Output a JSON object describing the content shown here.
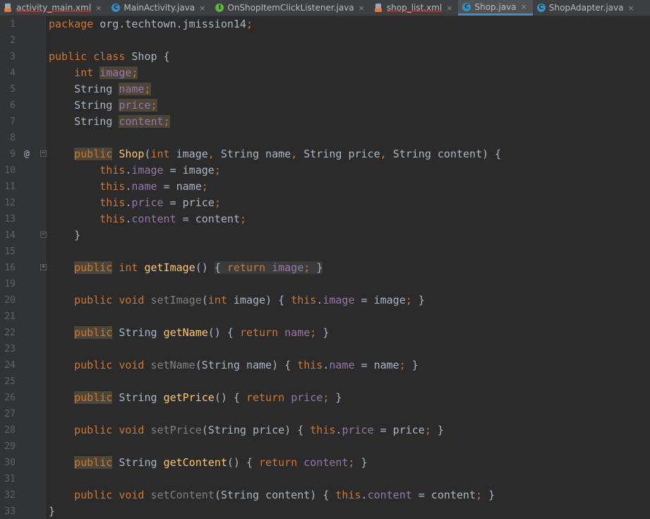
{
  "tabs": [
    {
      "label": "activity_main.xml",
      "icon": "xml-file-icon"
    },
    {
      "label": "MainActivity.java",
      "icon": "java-class-icon"
    },
    {
      "label": "OnShopItemClickListener.java",
      "icon": "java-interface-icon"
    },
    {
      "label": "shop_list.xml",
      "icon": "xml-file-icon"
    },
    {
      "label": "Shop.java",
      "icon": "java-class-icon",
      "active": true
    },
    {
      "label": "ShopAdapter.java",
      "icon": "java-class-icon"
    }
  ],
  "editor": {
    "lines": [
      {
        "n": "1",
        "tokens": [
          [
            "kw",
            "package "
          ],
          [
            "",
            "org.techtown.jmission14"
          ],
          [
            "kw",
            ";"
          ]
        ]
      },
      {
        "n": "2",
        "tokens": []
      },
      {
        "n": "3",
        "tokens": [
          [
            "kw",
            "public class "
          ],
          [
            "",
            "Shop {"
          ]
        ]
      },
      {
        "n": "4",
        "tokens": [
          [
            "",
            "    "
          ],
          [
            "kw",
            "int "
          ],
          [
            "fld hl",
            "image"
          ],
          [
            "kw hl",
            ";"
          ]
        ]
      },
      {
        "n": "5",
        "tokens": [
          [
            "",
            "    String "
          ],
          [
            "fld hl",
            "name"
          ],
          [
            "kw hl",
            ";"
          ]
        ]
      },
      {
        "n": "6",
        "tokens": [
          [
            "",
            "    String "
          ],
          [
            "fld hl",
            "price"
          ],
          [
            "kw hl",
            ";"
          ]
        ]
      },
      {
        "n": "7",
        "tokens": [
          [
            "",
            "    String "
          ],
          [
            "fld hl",
            "content"
          ],
          [
            "kw hl",
            ";"
          ]
        ]
      },
      {
        "n": "8",
        "tokens": []
      },
      {
        "n": "9",
        "mark": "@",
        "fold": "open",
        "tokens": [
          [
            "",
            "    "
          ],
          [
            "kw hl",
            "public"
          ],
          [
            "kw",
            " "
          ],
          [
            "fn",
            "Shop"
          ],
          [
            "",
            "("
          ],
          [
            "kw",
            "int "
          ],
          [
            "",
            "image"
          ],
          [
            "kw",
            ", "
          ],
          [
            "",
            "String name"
          ],
          [
            "kw",
            ", "
          ],
          [
            "",
            "String price"
          ],
          [
            "kw",
            ", "
          ],
          [
            "",
            "String content) {"
          ]
        ]
      },
      {
        "n": "10",
        "tokens": [
          [
            "",
            "        "
          ],
          [
            "kw",
            "this"
          ],
          [
            "",
            "."
          ],
          [
            "fld",
            "image"
          ],
          [
            "",
            " = image"
          ],
          [
            "kw",
            ";"
          ]
        ]
      },
      {
        "n": "11",
        "tokens": [
          [
            "",
            "        "
          ],
          [
            "kw",
            "this"
          ],
          [
            "",
            "."
          ],
          [
            "fld",
            "name"
          ],
          [
            "",
            " = name"
          ],
          [
            "kw",
            ";"
          ]
        ]
      },
      {
        "n": "12",
        "tokens": [
          [
            "",
            "        "
          ],
          [
            "kw",
            "this"
          ],
          [
            "",
            "."
          ],
          [
            "fld",
            "price"
          ],
          [
            "",
            " = price"
          ],
          [
            "kw",
            ";"
          ]
        ]
      },
      {
        "n": "13",
        "tokens": [
          [
            "",
            "        "
          ],
          [
            "kw",
            "this"
          ],
          [
            "",
            "."
          ],
          [
            "fld",
            "content"
          ],
          [
            "",
            " = content"
          ],
          [
            "kw",
            ";"
          ]
        ]
      },
      {
        "n": "14",
        "fold": "close",
        "tokens": [
          [
            "",
            "    }"
          ]
        ]
      },
      {
        "n": "15",
        "tokens": []
      },
      {
        "n": "16",
        "fold": "plus",
        "tokens": [
          [
            "",
            "    "
          ],
          [
            "kw hl",
            "public"
          ],
          [
            "kw",
            " int "
          ],
          [
            "fn",
            "getImage"
          ],
          [
            "",
            "() "
          ],
          [
            "br",
            "{ "
          ],
          [
            "kw br",
            "return "
          ],
          [
            "fld br",
            "image"
          ],
          [
            "kw br",
            "; "
          ],
          [
            "br",
            "}"
          ]
        ]
      },
      {
        "n": "19",
        "tokens": []
      },
      {
        "n": "20",
        "tokens": [
          [
            "",
            "    "
          ],
          [
            "kw",
            "public void "
          ],
          [
            "dim",
            "setImage"
          ],
          [
            "",
            "("
          ],
          [
            "kw",
            "int "
          ],
          [
            "",
            "image) { "
          ],
          [
            "kw",
            "this"
          ],
          [
            "",
            "."
          ],
          [
            "fld",
            "image"
          ],
          [
            "",
            " = image"
          ],
          [
            "kw",
            "; "
          ],
          [
            "",
            "}"
          ]
        ]
      },
      {
        "n": "21",
        "tokens": []
      },
      {
        "n": "22",
        "tokens": [
          [
            "",
            "    "
          ],
          [
            "kw hl",
            "public"
          ],
          [
            "",
            " String "
          ],
          [
            "fn",
            "getName"
          ],
          [
            "",
            "() { "
          ],
          [
            "kw",
            "return "
          ],
          [
            "fld",
            "name"
          ],
          [
            "kw",
            "; "
          ],
          [
            "",
            "}"
          ]
        ]
      },
      {
        "n": "23",
        "tokens": []
      },
      {
        "n": "24",
        "tokens": [
          [
            "",
            "    "
          ],
          [
            "kw",
            "public void "
          ],
          [
            "dim",
            "setName"
          ],
          [
            "",
            "(String name) { "
          ],
          [
            "kw",
            "this"
          ],
          [
            "",
            "."
          ],
          [
            "fld",
            "name"
          ],
          [
            "",
            " = name"
          ],
          [
            "kw",
            "; "
          ],
          [
            "",
            "}"
          ]
        ]
      },
      {
        "n": "25",
        "tokens": []
      },
      {
        "n": "26",
        "tokens": [
          [
            "",
            "    "
          ],
          [
            "kw hl",
            "public"
          ],
          [
            "",
            " String "
          ],
          [
            "fn",
            "getPrice"
          ],
          [
            "",
            "() { "
          ],
          [
            "kw",
            "return "
          ],
          [
            "fld",
            "price"
          ],
          [
            "kw",
            "; "
          ],
          [
            "",
            "}"
          ]
        ]
      },
      {
        "n": "27",
        "tokens": []
      },
      {
        "n": "28",
        "tokens": [
          [
            "",
            "    "
          ],
          [
            "kw",
            "public void "
          ],
          [
            "dim",
            "setPrice"
          ],
          [
            "",
            "(String price) { "
          ],
          [
            "kw",
            "this"
          ],
          [
            "",
            "."
          ],
          [
            "fld",
            "price"
          ],
          [
            "",
            " = price"
          ],
          [
            "kw",
            "; "
          ],
          [
            "",
            "}"
          ]
        ]
      },
      {
        "n": "29",
        "tokens": []
      },
      {
        "n": "30",
        "tokens": [
          [
            "",
            "    "
          ],
          [
            "kw hl",
            "public"
          ],
          [
            "",
            " String "
          ],
          [
            "fn",
            "getContent"
          ],
          [
            "",
            "() { "
          ],
          [
            "kw",
            "return "
          ],
          [
            "fld",
            "content"
          ],
          [
            "kw",
            "; "
          ],
          [
            "",
            "}"
          ]
        ]
      },
      {
        "n": "31",
        "tokens": []
      },
      {
        "n": "32",
        "tokens": [
          [
            "",
            "    "
          ],
          [
            "kw",
            "public void "
          ],
          [
            "dim",
            "setContent"
          ],
          [
            "",
            "(String content) { "
          ],
          [
            "kw",
            "this"
          ],
          [
            "",
            "."
          ],
          [
            "fld",
            "content"
          ],
          [
            "",
            " = content"
          ],
          [
            "kw",
            "; "
          ],
          [
            "",
            "}"
          ]
        ]
      },
      {
        "n": "33",
        "tokens": [
          [
            "",
            "}"
          ]
        ]
      }
    ]
  },
  "colors": {
    "background": "#2b2b2b",
    "keyword": "#cc7832",
    "field": "#9876aa",
    "method": "#ffc66d",
    "text": "#a9b7c6",
    "active_tab_underline": "#4a88c7"
  }
}
